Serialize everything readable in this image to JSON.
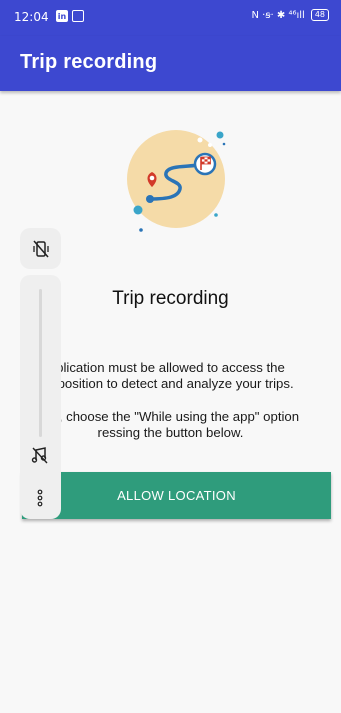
{
  "status_bar": {
    "time": "12:04",
    "left_icons": [
      "linkedin-icon",
      "newspaper-icon"
    ],
    "right_text": "N ·ꞩ· ✱ ⁴⁶ıll",
    "battery": "48"
  },
  "app_bar": {
    "title": "Trip recording"
  },
  "content": {
    "title": "Trip recording",
    "paragraph1_line1": "plication must be allowed to access the",
    "paragraph1_line2": "s position to detect and analyze your trips.",
    "paragraph2_line1": "his, choose the \"While using the app\" option",
    "paragraph2_line2": "ressing the button below.",
    "button_label": "ALLOW LOCATION"
  },
  "volume_panel": {
    "top_icon": "vibrate-off-icon",
    "music_icon": "music-off-icon",
    "more_icon": "more-vertical-icon",
    "level": 0
  },
  "colors": {
    "primary": "#3d48d0",
    "accent": "#2f9c7c",
    "illustration_bg": "#f5dba8",
    "pin_red": "#d23a2a",
    "route_blue": "#2a74b7"
  }
}
